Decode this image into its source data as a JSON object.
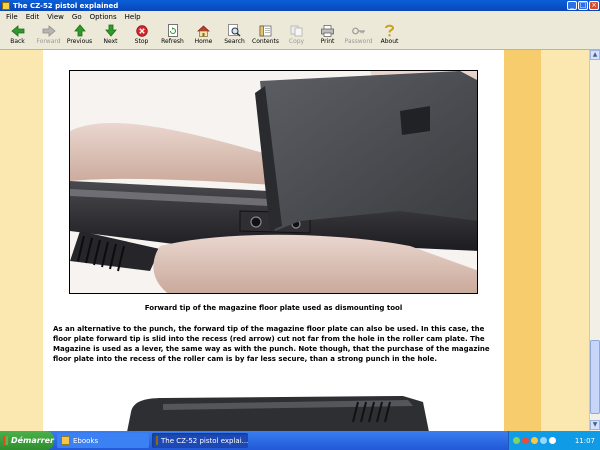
{
  "window": {
    "title": "The CZ-52 pistol explained",
    "controls": [
      "minimize",
      "maximize",
      "close"
    ]
  },
  "menu": {
    "items": [
      "File",
      "Edit",
      "View",
      "Go",
      "Options",
      "Help"
    ]
  },
  "toolbar": {
    "buttons": [
      {
        "label": "Back",
        "icon": "back-arrow-icon",
        "enabled": true
      },
      {
        "label": "Forward",
        "icon": "forward-arrow-icon",
        "enabled": false
      },
      {
        "label": "Previous",
        "icon": "previous-arrow-icon",
        "enabled": true
      },
      {
        "label": "Next",
        "icon": "next-arrow-icon",
        "enabled": true
      },
      {
        "label": "Stop",
        "icon": "stop-icon",
        "enabled": true
      },
      {
        "label": "Refresh",
        "icon": "refresh-icon",
        "enabled": true
      },
      {
        "label": "Home",
        "icon": "home-icon",
        "enabled": true
      },
      {
        "label": "Search",
        "icon": "search-icon",
        "enabled": true
      },
      {
        "label": "Contents",
        "icon": "contents-icon",
        "enabled": true
      },
      {
        "label": "Copy",
        "icon": "copy-icon",
        "enabled": false
      },
      {
        "label": "Print",
        "icon": "print-icon",
        "enabled": true
      },
      {
        "label": "Password",
        "icon": "key-icon",
        "enabled": false
      },
      {
        "label": "About",
        "icon": "about-icon",
        "enabled": true
      }
    ]
  },
  "page": {
    "caption": "Forward tip of the magazine floor plate used as dismounting tool",
    "paragraph": "As an alternative to the punch, the forward tip of the magazine floor plate can also be used. In this case, the floor plate forward tip is slid into the recess (red arrow) cut not far from the hole in the roller cam plate. The Magazine is used as a lever, the same way as with the punch. Note though, that the purchase of the magazine floor plate into the recess of the roller cam is by far less secure, than a strong punch in the hole."
  },
  "taskbar": {
    "start_label": "Démarrer",
    "tasks": [
      {
        "label": "Ebooks",
        "active": false
      },
      {
        "label": "The CZ-52 pistol explai...",
        "active": true
      }
    ],
    "clock": "11:07"
  },
  "colors": {
    "page_background": "#fbe7b0",
    "column_accent": "#f7cc6c",
    "title_bar": "#0a5fd8",
    "taskbar": "#2158d6"
  }
}
